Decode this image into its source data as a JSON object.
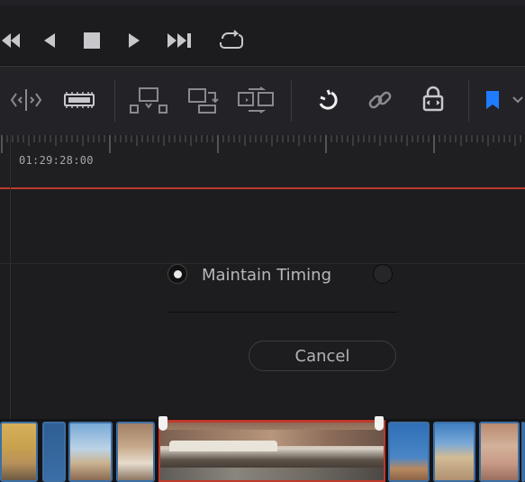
{
  "transport": {
    "buttons": [
      "skip-to-start-icon",
      "step-back-icon",
      "stop-icon",
      "play-icon",
      "skip-to-end-icon",
      "loop-icon"
    ]
  },
  "toolbar": {
    "icons": [
      "slip-icon",
      "razor-blade-icon",
      "insert-clip-icon",
      "overwrite-clip-icon",
      "replace-clip-icon",
      "snapping-icon",
      "link-icon",
      "lock-icon",
      "flag-icon",
      "chevron-down-icon"
    ],
    "accent_color": "#1f7cff"
  },
  "ruler": {
    "timecode": "01:29:28:00"
  },
  "dialog": {
    "option_label": "Maintain Timing",
    "cancel_label": "Cancel"
  },
  "colors": {
    "playhead": "#c0392b",
    "clip_border": "#3d6fa4",
    "selected_clip_border": "#c0392b"
  }
}
